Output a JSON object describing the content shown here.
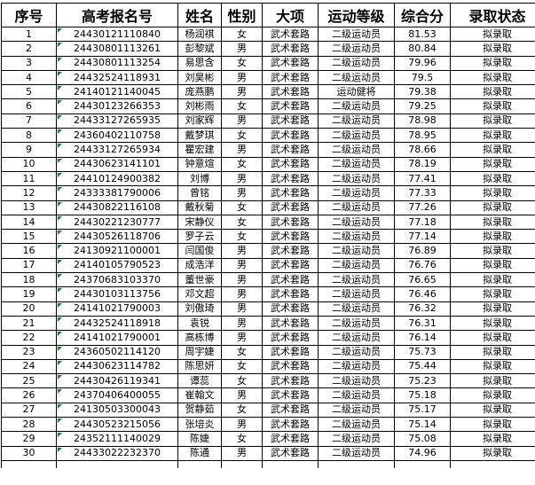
{
  "headers": [
    "序号",
    "高考报名号",
    "姓名",
    "性别",
    "大项",
    "运动等级",
    "综合分",
    "录取状态"
  ],
  "rows": [
    [
      "1",
      "24430121110840",
      "杨润祺",
      "女",
      "武术套路",
      "二级运动员",
      "81.53",
      "拟录取"
    ],
    [
      "2",
      "24430801113261",
      "彭黎斌",
      "男",
      "武术套路",
      "二级运动员",
      "80.84",
      "拟录取"
    ],
    [
      "3",
      "24430801113254",
      "易思含",
      "女",
      "武术套路",
      "二级运动员",
      "79.96",
      "拟录取"
    ],
    [
      "4",
      "24432524118931",
      "刘昊彬",
      "男",
      "武术套路",
      "二级运动员",
      "79.5",
      "拟录取"
    ],
    [
      "5",
      "24140121140045",
      "庞燕鹏",
      "男",
      "武术套路",
      "运动健将",
      "79.38",
      "拟录取"
    ],
    [
      "6",
      "24430123266353",
      "刘彬雨",
      "女",
      "武术套路",
      "二级运动员",
      "79.25",
      "拟录取"
    ],
    [
      "7",
      "24433127265935",
      "刘家辉",
      "男",
      "武术套路",
      "二级运动员",
      "78.98",
      "拟录取"
    ],
    [
      "8",
      "24360402110758",
      "戴梦琪",
      "女",
      "武术套路",
      "二级运动员",
      "78.95",
      "拟录取"
    ],
    [
      "9",
      "24433127265934",
      "瞿宏建",
      "男",
      "武术套路",
      "二级运动员",
      "78.66",
      "拟录取"
    ],
    [
      "10",
      "24430623141101",
      "钟意煊",
      "女",
      "武术套路",
      "二级运动员",
      "78.19",
      "拟录取"
    ],
    [
      "11",
      "24410124900382",
      "刘博",
      "男",
      "武术套路",
      "二级运动员",
      "77.41",
      "拟录取"
    ],
    [
      "12",
      "24333381790006",
      "曾铭",
      "男",
      "武术套路",
      "二级运动员",
      "77.33",
      "拟录取"
    ],
    [
      "13",
      "24430822116108",
      "戴秋菊",
      "女",
      "武术套路",
      "二级运动员",
      "77.26",
      "拟录取"
    ],
    [
      "14",
      "24430221230777",
      "宋静仪",
      "女",
      "武术套路",
      "二级运动员",
      "77.18",
      "拟录取"
    ],
    [
      "15",
      "24430526118706",
      "罗子云",
      "女",
      "武术套路",
      "二级运动员",
      "77.14",
      "拟录取"
    ],
    [
      "16",
      "24130921100001",
      "闫国俊",
      "男",
      "武术套路",
      "二级运动员",
      "76.89",
      "拟录取"
    ],
    [
      "17",
      "24140105790523",
      "成浩洋",
      "男",
      "武术套路",
      "二级运动员",
      "76.76",
      "拟录取"
    ],
    [
      "18",
      "24370683103370",
      "董世豪",
      "男",
      "武术套路",
      "二级运动员",
      "76.65",
      "拟录取"
    ],
    [
      "19",
      "24430103113756",
      "邓文超",
      "男",
      "武术套路",
      "二级运动员",
      "76.46",
      "拟录取"
    ],
    [
      "20",
      "24141021790003",
      "刘傲琦",
      "男",
      "武术套路",
      "二级运动员",
      "76.32",
      "拟录取"
    ],
    [
      "21",
      "24432524118918",
      "袁锐",
      "男",
      "武术套路",
      "二级运动员",
      "76.31",
      "拟录取"
    ],
    [
      "22",
      "24141021790001",
      "高栋博",
      "男",
      "武术套路",
      "二级运动员",
      "76.14",
      "拟录取"
    ],
    [
      "23",
      "24360502114120",
      "周宇婕",
      "女",
      "武术套路",
      "二级运动员",
      "75.73",
      "拟录取"
    ],
    [
      "24",
      "24430623114782",
      "陈思妍",
      "女",
      "武术套路",
      "二级运动员",
      "75.44",
      "拟录取"
    ],
    [
      "25",
      "24430426119341",
      "谭蕊",
      "女",
      "武术套路",
      "二级运动员",
      "75.23",
      "拟录取"
    ],
    [
      "26",
      "24370406400055",
      "崔翰文",
      "男",
      "武术套路",
      "二级运动员",
      "75.18",
      "拟录取"
    ],
    [
      "27",
      "24130503300043",
      "贺静茹",
      "女",
      "武术套路",
      "二级运动员",
      "75.17",
      "拟录取"
    ],
    [
      "28",
      "24430523215056",
      "张培炎",
      "男",
      "武术套路",
      "二级运动员",
      "75.14",
      "拟录取"
    ],
    [
      "29",
      "24352111140029",
      "陈婕",
      "女",
      "武术套路",
      "二级运动员",
      "75.08",
      "拟录取"
    ],
    [
      "30",
      "24433022232370",
      "陈通",
      "男",
      "武术套路",
      "二级运动员",
      "74.96",
      "拟录取"
    ]
  ]
}
